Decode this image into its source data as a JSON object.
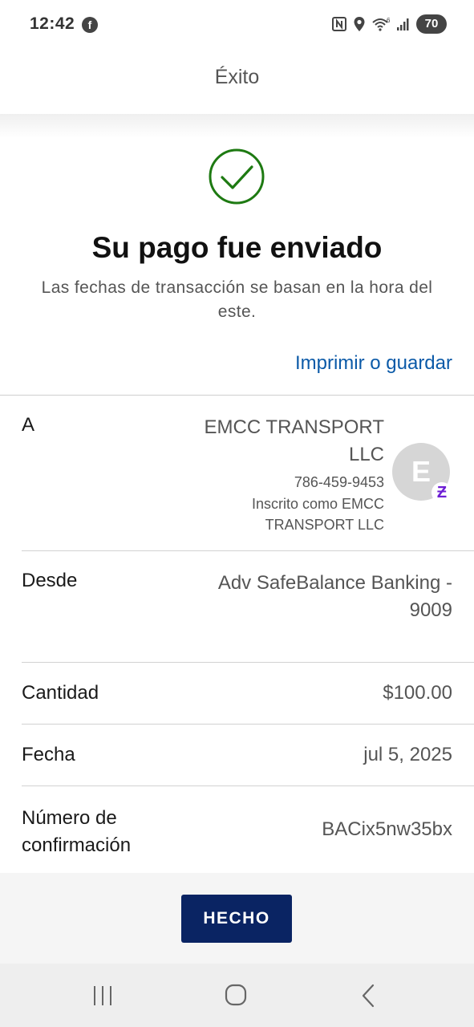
{
  "status_bar": {
    "time": "12:42",
    "notification_icon": "facebook-icon",
    "battery": "70",
    "icons": [
      "nfc-icon",
      "location-icon",
      "wifi-icon",
      "signal-icon"
    ]
  },
  "header": {
    "title": "Éxito"
  },
  "success": {
    "icon": "check-circle-icon",
    "icon_color": "#1e7a12",
    "title": "Su pago fue enviado",
    "subtitle": "Las fechas de transacción se basan en la hora del este.",
    "print_link": "Imprimir o guardar",
    "link_color": "#0b5aa8"
  },
  "details": {
    "to": {
      "label": "A",
      "name": "EMCC TRANSPORT LLC",
      "phone": "786-459-9453",
      "registered_as": "Inscrito como EMCC TRANSPORT LLC",
      "avatar_initial": "E",
      "badge_icon": "zelle-icon",
      "badge_glyph": "Ƶ"
    },
    "from": {
      "label": "Desde",
      "value": "Adv SafeBalance Banking - 9009"
    },
    "amount": {
      "label": "Cantidad",
      "value": "$100.00"
    },
    "date": {
      "label": "Fecha",
      "value": "jul 5, 2025"
    },
    "confirmation": {
      "label": "Número de confirmación",
      "value": "BACix5nw35bx"
    }
  },
  "footer": {
    "done_label": "HECHO",
    "button_color": "#0a2463"
  },
  "nav_bar": {
    "buttons": [
      "recent-apps-icon",
      "home-icon",
      "back-icon"
    ]
  }
}
